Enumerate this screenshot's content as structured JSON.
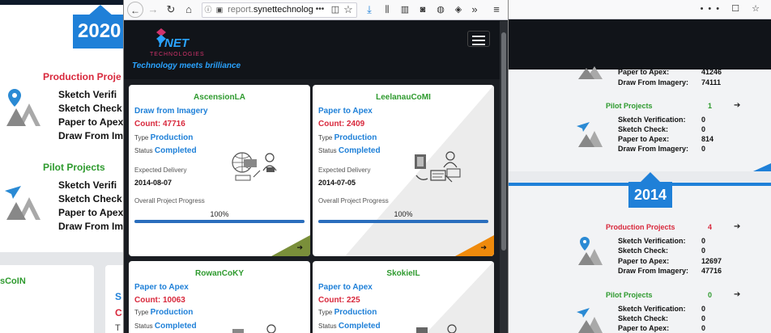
{
  "left_window": {
    "year": "2020",
    "production_title": "Production Proje",
    "production_rows": [
      "Sketch Verifi",
      "Sketch Check",
      "Paper to Apex",
      "Draw From Im"
    ],
    "pilot_title": "Pilot Projects",
    "pilot_rows": [
      "Sketch Verifi",
      "Sketch Check",
      "Paper to Apex",
      "Draw From Im"
    ],
    "bottom_left_text": "sCoIN",
    "bottom_right_s": "S",
    "bottom_right_c": "C",
    "bottom_right_t": "T",
    "colors": {
      "production": "#d8283c",
      "pilot": "#2e9a2e",
      "year_tab": "#1f80d8"
    }
  },
  "right_window": {
    "card1": {
      "rows_top": [
        {
          "label": "Paper to Apex:",
          "value": "41246"
        },
        {
          "label": "Draw From Imagery:",
          "value": "74111"
        }
      ],
      "pilot_title": "Pilot Projects",
      "pilot_count": "1",
      "pilot_rows": [
        {
          "label": "Sketch Verification:",
          "value": "0"
        },
        {
          "label": "Sketch Check:",
          "value": "0"
        },
        {
          "label": "Paper to Apex:",
          "value": "814"
        },
        {
          "label": "Draw From Imagery:",
          "value": "0"
        }
      ]
    },
    "year": "2014",
    "card2": {
      "production_title": "Production Projects",
      "production_count": "4",
      "production_rows": [
        {
          "label": "Sketch Verification:",
          "value": "0"
        },
        {
          "label": "Sketch Check:",
          "value": "0"
        },
        {
          "label": "Paper to Apex:",
          "value": "12697"
        },
        {
          "label": "Draw From Imagery:",
          "value": "47716"
        }
      ],
      "pilot_title": "Pilot Projects",
      "pilot_count": "0",
      "pilot_rows": [
        {
          "label": "Sketch Verification:",
          "value": "0"
        },
        {
          "label": "Sketch Check:",
          "value": "0"
        },
        {
          "label": "Paper to Apex:",
          "value": "0"
        }
      ]
    }
  },
  "browser": {
    "url_prefix": "report.",
    "url_domain": "synettechnolog",
    "url_more": "•••"
  },
  "site": {
    "logo_main": "YNET",
    "logo_sub": "TECHNOLOGIES",
    "logo_tag": "Technology meets brilliance"
  },
  "cards": [
    {
      "name": "AscensionLA",
      "type_title": "Draw from Imagery",
      "count_label": "Count: 47716",
      "type_label": "Type",
      "type_value": "Production",
      "status_label": "Status",
      "status_value": "Completed",
      "delivery_label": "Expected Delivery",
      "delivery_date": "2014-08-07",
      "progress_label": "Overall Project Progress",
      "progress_text": "100%",
      "progress": 1.0,
      "corner_color": "#7a8f3a"
    },
    {
      "name": "LeelanauCoMI",
      "type_title": "Paper to Apex",
      "count_label": "Count: 2409",
      "type_label": "Type",
      "type_value": "Production",
      "status_label": "Status",
      "status_value": "Completed",
      "delivery_label": "Expected Delivery",
      "delivery_date": "2014-07-05",
      "progress_label": "Overall Project Progress",
      "progress_text": "100%",
      "progress": 1.0,
      "corner_color": "#ef8a0c"
    },
    {
      "name": "RowanCoKY",
      "type_title": "Paper to Apex",
      "count_label": "Count: 10063",
      "type_label": "Type",
      "type_value": "Production",
      "status_label": "Status",
      "status_value": "Completed"
    },
    {
      "name": "SkokieIL",
      "type_title": "Paper to Apex",
      "count_label": "Count: 225",
      "type_label": "Type",
      "type_value": "Production",
      "status_label": "Status",
      "status_value": "Completed"
    }
  ]
}
